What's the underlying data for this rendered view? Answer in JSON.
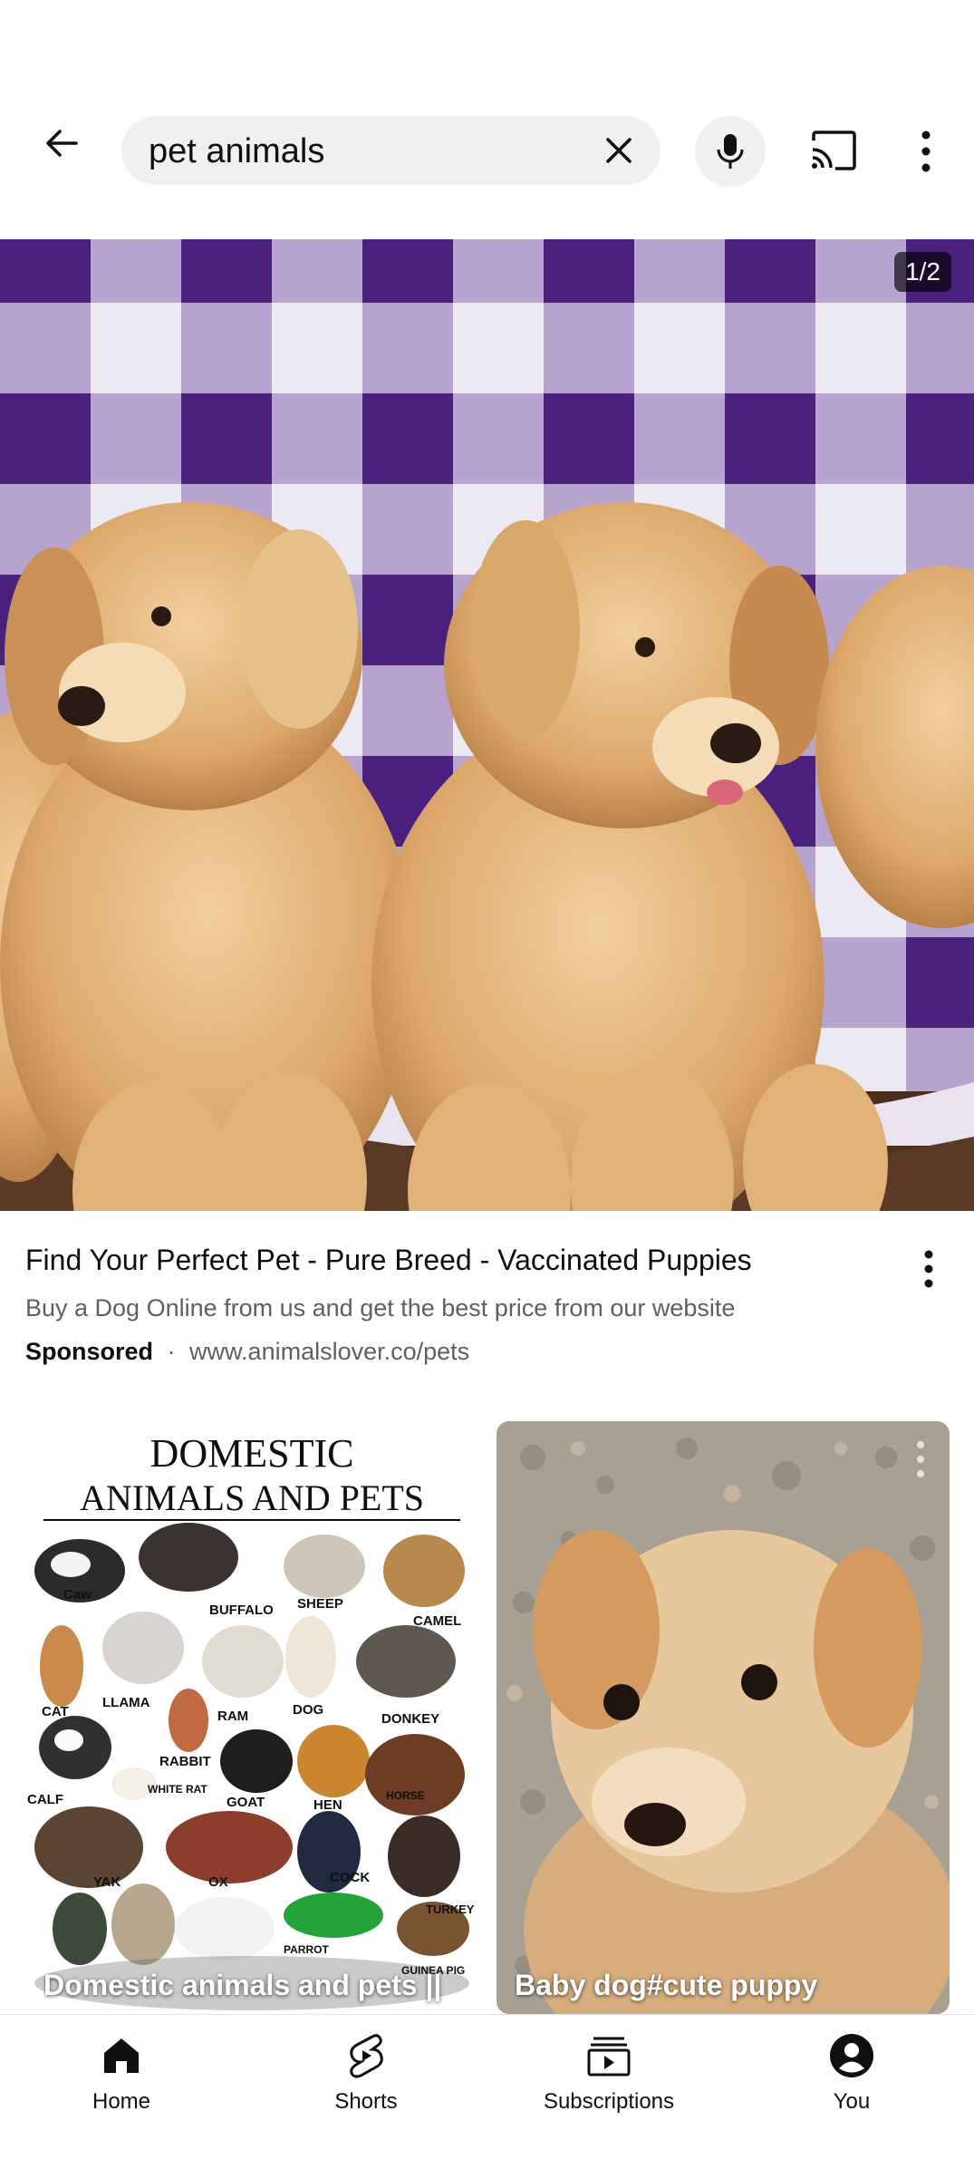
{
  "search": {
    "query": "pet animals"
  },
  "icons": {
    "back": "arrow-left-icon",
    "clear": "close-icon",
    "mic": "microphone-icon",
    "cast": "cast-icon",
    "more": "more-vert-icon"
  },
  "ad": {
    "counter": "1/2",
    "title": "Find Your Perfect Pet - Pure Breed - Vaccinated Puppies",
    "description": "Buy a Dog Online from us and get the best price from our website",
    "sponsored": "Sponsored",
    "separator": "·",
    "url": "www.animalslover.co/pets"
  },
  "shorts": [
    {
      "title": "Domestic animals and pets ||",
      "poster_heading_line1": "DOMESTIC",
      "poster_heading_line2": "ANIMALS AND PETS",
      "poster_labels": [
        "Caw",
        "BUFFALO",
        "SHEEP",
        "CAMEL",
        "CAT",
        "LLAMA",
        "RAM",
        "DOG",
        "DONKEY",
        "RABBIT",
        "CALF",
        "WHITE RAT",
        "GOAT",
        "HEN",
        "HORSE",
        "YAK",
        "OX",
        "COCK",
        "TURKEY",
        "PARROT",
        "GUINEA PIG"
      ]
    },
    {
      "title": "Baby dog#cute puppy"
    }
  ],
  "nav": {
    "items": [
      {
        "label": "Home",
        "icon": "home-icon"
      },
      {
        "label": "Shorts",
        "icon": "shorts-icon"
      },
      {
        "label": "Subscriptions",
        "icon": "subscriptions-icon"
      },
      {
        "label": "You",
        "icon": "account-icon"
      }
    ]
  },
  "colors": {
    "accent": "#0f0f0f",
    "secondary_text": "#606060",
    "pill_bg": "#f0f0f0",
    "checker_purple": "#5a2a8a"
  }
}
